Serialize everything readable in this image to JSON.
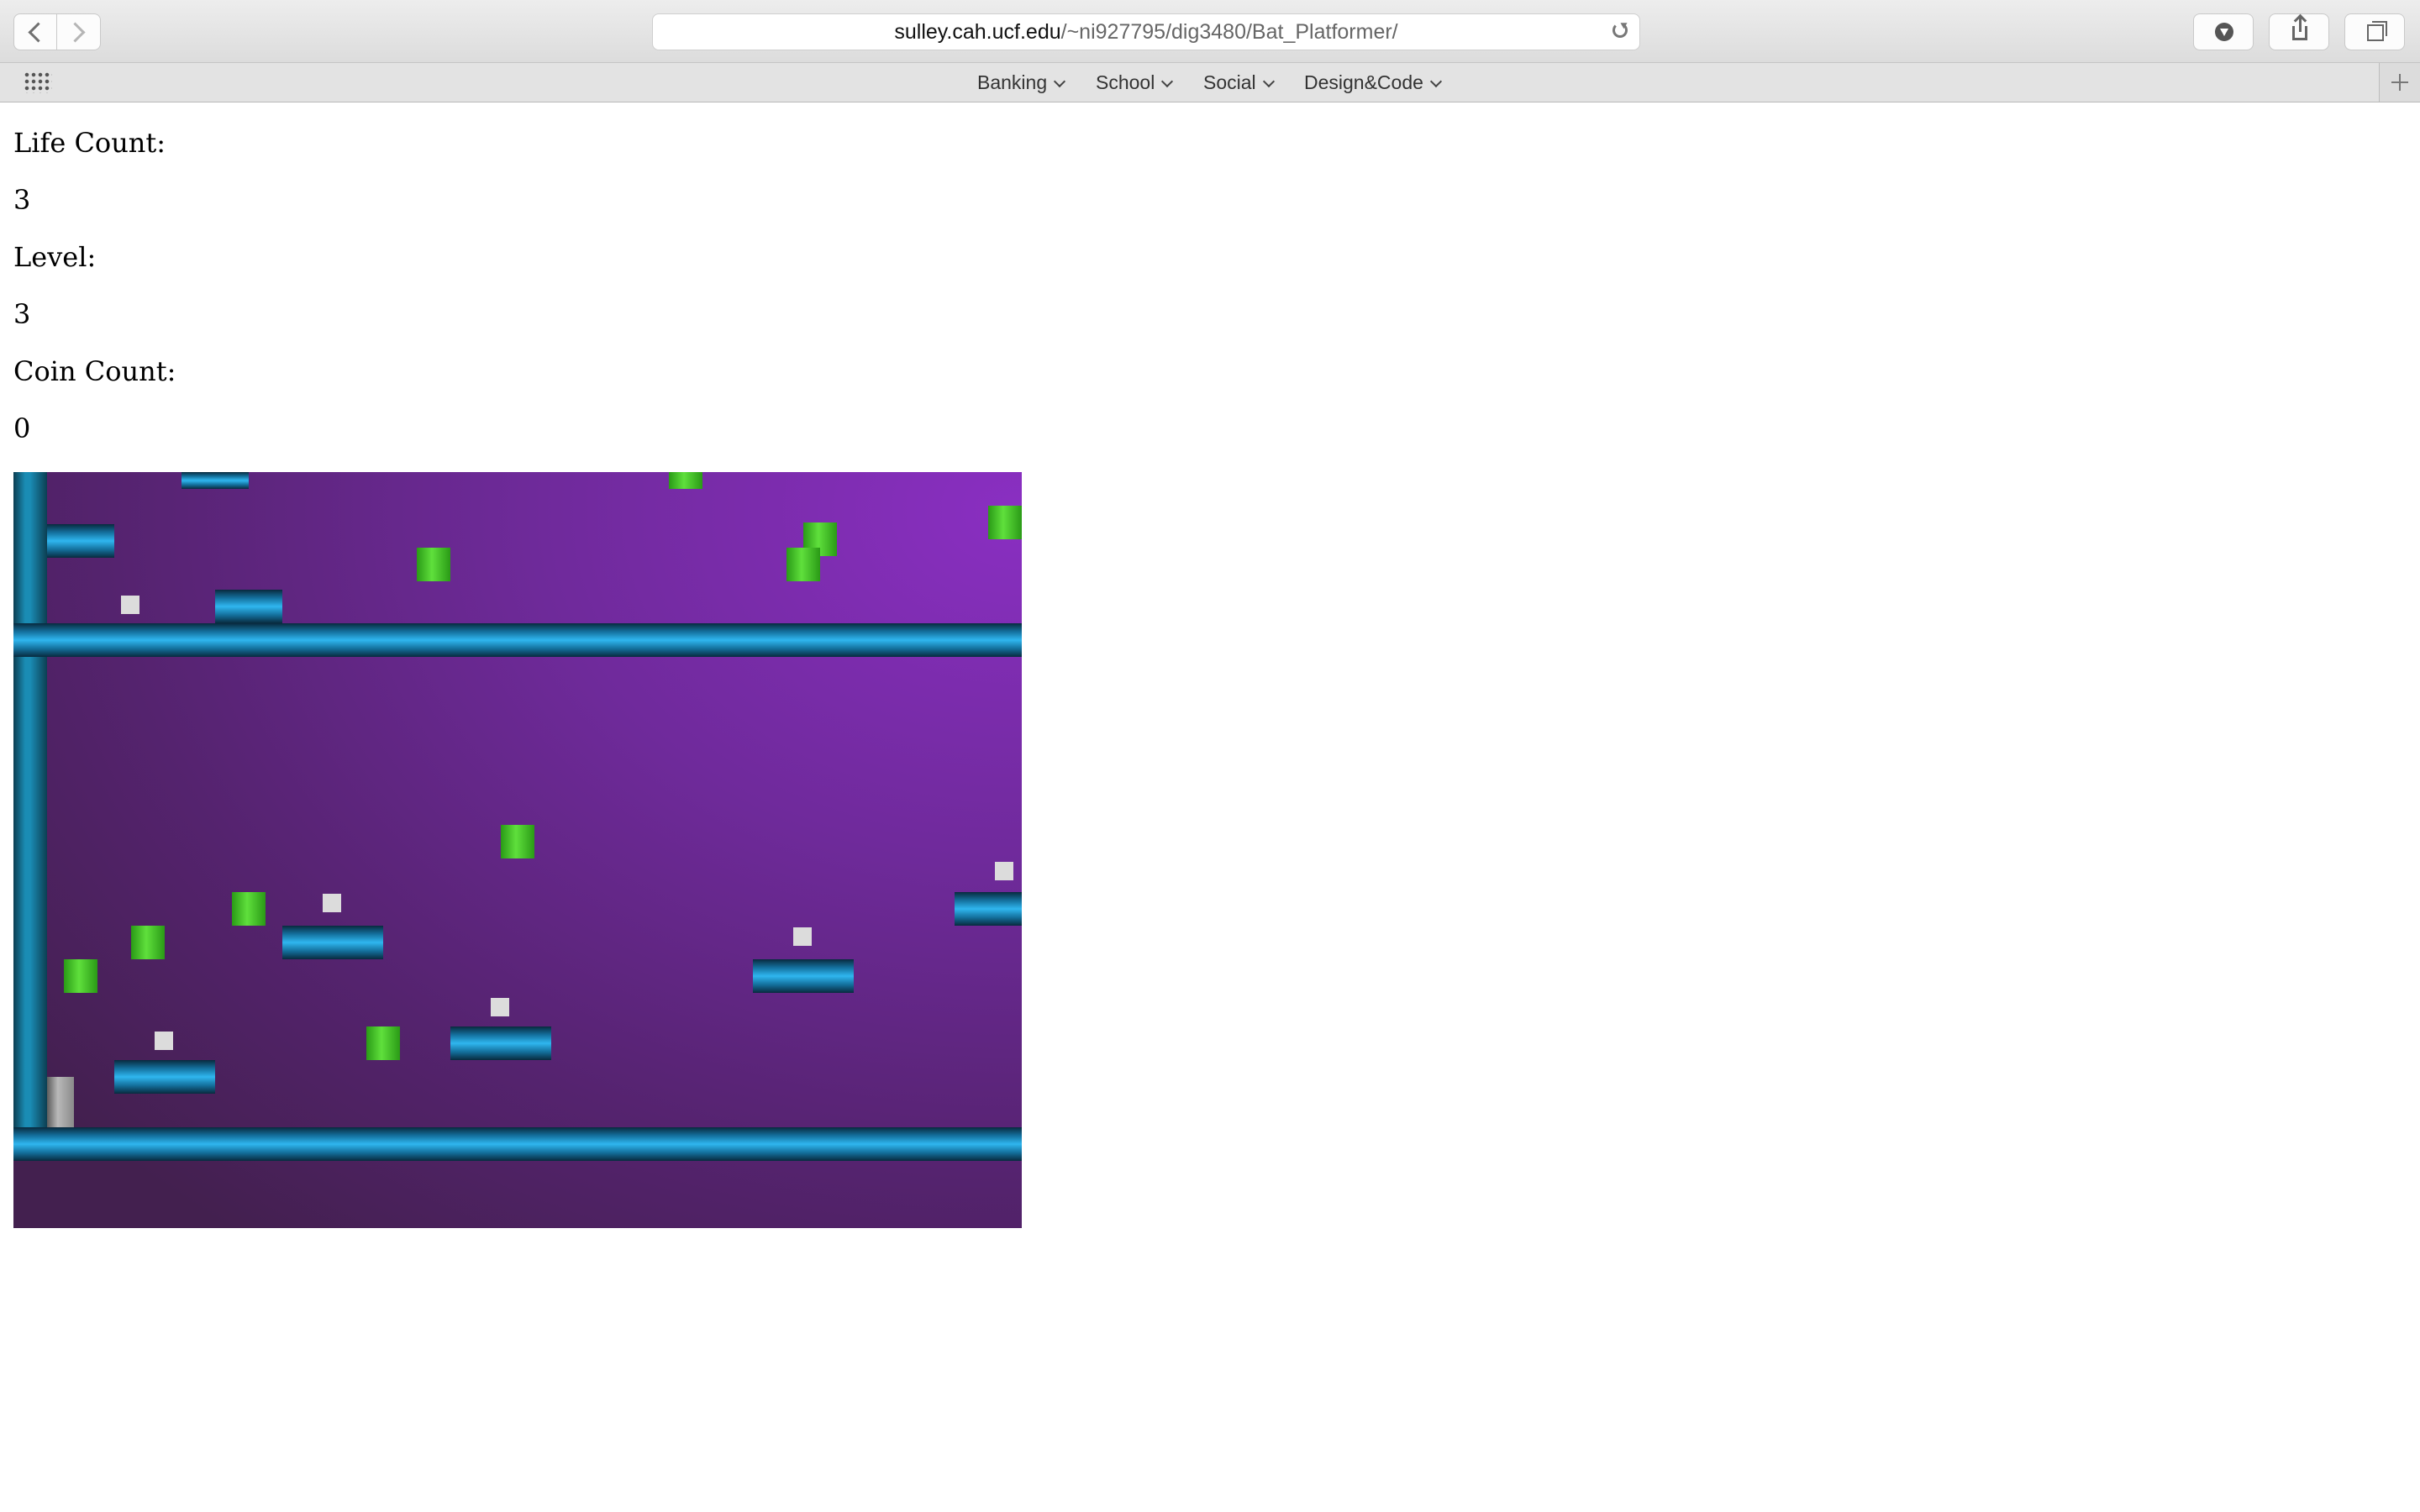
{
  "browser": {
    "url_host": "sulley.cah.ucf.edu",
    "url_path": "/~ni927795/dig3480/Bat_Platformer/",
    "icons": [
      "back-icon",
      "forward-icon",
      "reload-icon",
      "download-icon",
      "share-icon",
      "tabs-icon",
      "grid-icon",
      "plus-icon"
    ]
  },
  "favorites": [
    {
      "label": "Banking"
    },
    {
      "label": "School"
    },
    {
      "label": "Social"
    },
    {
      "label": "Design&Code"
    }
  ],
  "hud": {
    "life_label": "Life Count:",
    "life_value": "3",
    "level_label": "Level:",
    "level_value": "3",
    "coin_label": "Coin Count:",
    "coin_value": "0"
  },
  "game": {
    "background_color": "#6f2a9b",
    "platform_color": "#2fb6ef",
    "coin_color": "#5fe03c",
    "spike_color": "#dcdcdc",
    "player_color": "#b9b9b9"
  }
}
